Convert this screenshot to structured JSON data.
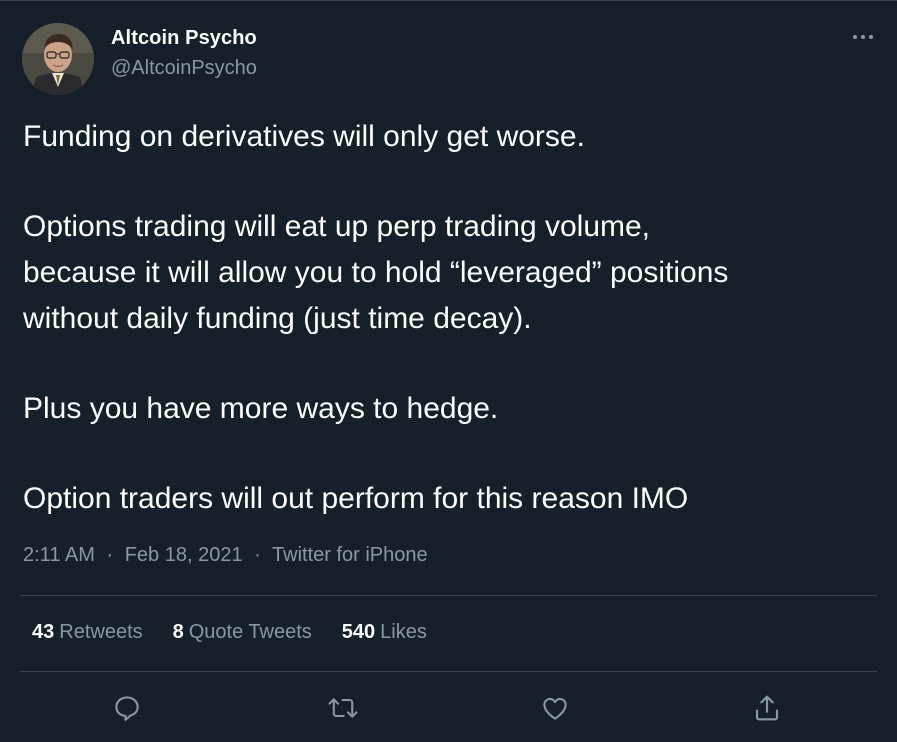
{
  "author": {
    "display_name": "Altcoin Psycho",
    "handle": "@AltcoinPsycho"
  },
  "tweet": {
    "paragraphs": [
      [
        "Funding on derivatives will only get worse."
      ],
      [
        "Options trading will eat up perp trading volume,",
        "because it will allow you to hold “leveraged” positions",
        "without daily funding (just time decay)."
      ],
      [
        "Plus you have more ways to hedge."
      ],
      [
        "Option traders will out perform for this reason IMO"
      ]
    ],
    "time": "2:11 AM",
    "separator": "·",
    "date": "Feb 18, 2021",
    "source": "Twitter for iPhone"
  },
  "stats": {
    "retweets": {
      "count": "43",
      "label": "Retweets"
    },
    "quote_tweets": {
      "count": "8",
      "label": "Quote Tweets"
    },
    "likes": {
      "count": "540",
      "label": "Likes"
    }
  },
  "colors": {
    "background": "#15202b",
    "text_primary": "#ffffff",
    "text_secondary": "#8899a6",
    "divider": "#38444d"
  },
  "icons": {
    "more": "more-horizontal-icon",
    "reply": "reply-icon",
    "retweet": "retweet-icon",
    "like": "heart-icon",
    "share": "share-icon"
  }
}
